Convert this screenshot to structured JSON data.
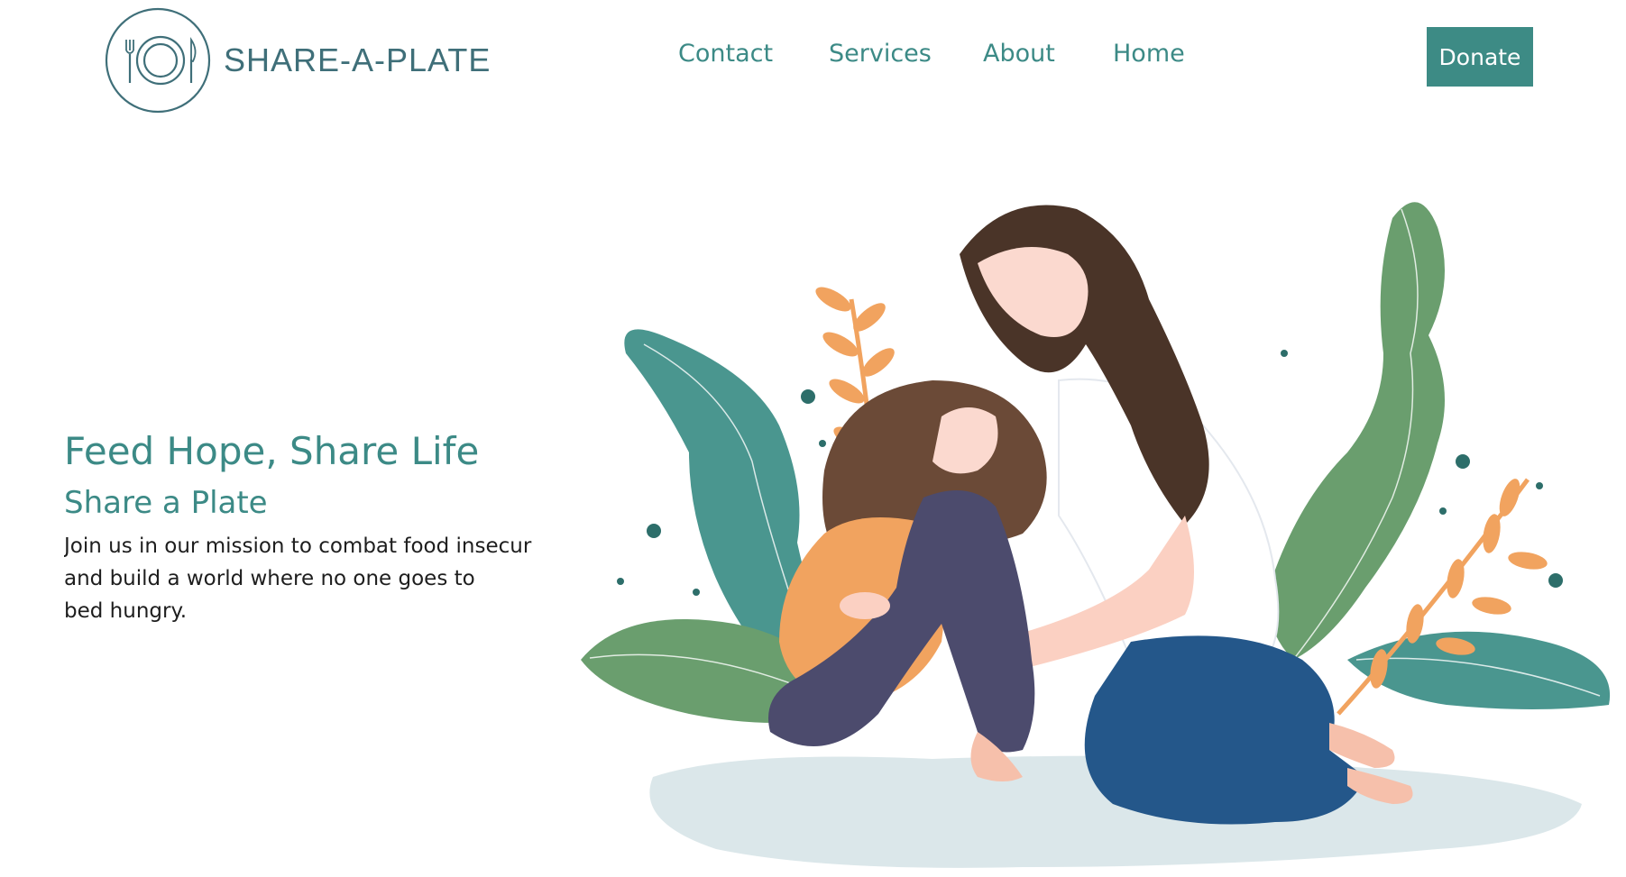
{
  "brand": {
    "name": "SHARE-A-PLATE"
  },
  "nav": {
    "items": [
      {
        "label": "Contact"
      },
      {
        "label": "Services"
      },
      {
        "label": "About"
      },
      {
        "label": "Home"
      }
    ],
    "donate_label": "Donate"
  },
  "hero": {
    "title": "Feed Hope, Share Life",
    "subtitle": "Share a Plate",
    "description_lines": [
      "Join us in our mission to combat food insecur",
      "and build a world where no one goes to",
      "bed hungry."
    ]
  },
  "colors": {
    "accent": "#3d8b85",
    "logo": "#3f6f79",
    "leaf_teal": "#4a968f",
    "leaf_green": "#6a9e6e",
    "orange": "#f1a35f"
  },
  "icons": {
    "logo": "plate-fork-knife-icon"
  }
}
